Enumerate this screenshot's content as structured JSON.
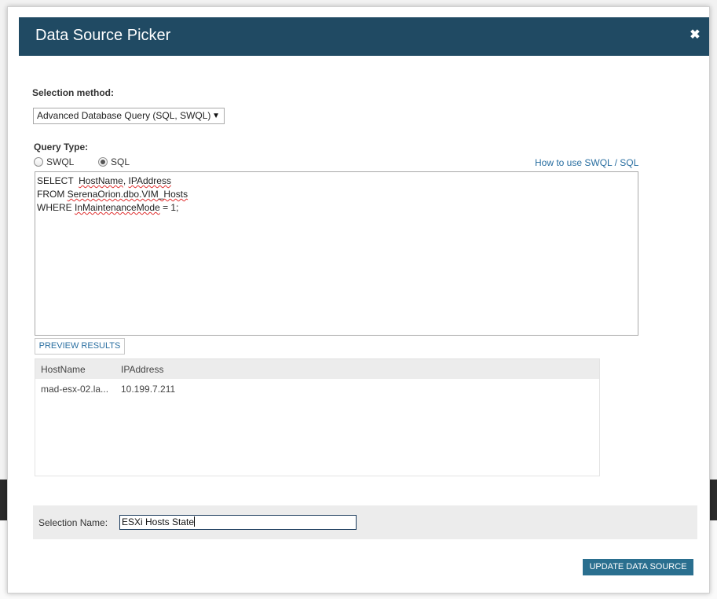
{
  "dialog": {
    "title": "Data Source Picker",
    "close_glyph": "✖"
  },
  "selection_method": {
    "label": "Selection method:",
    "selected": "Advanced Database Query (SQL, SWQL)",
    "arrow": "▼"
  },
  "query_type": {
    "label": "Query Type:",
    "options": [
      {
        "label": "SWQL",
        "checked": false
      },
      {
        "label": "SQL",
        "checked": true
      }
    ],
    "help_link": "How to use SWQL / SQL"
  },
  "query": {
    "line1_prefix": "SELECT  ",
    "line1_word1": "HostName",
    "line1_sep": ", ",
    "line1_word2": "IPAddress",
    "line2_prefix": "FROM ",
    "line2_word": "SerenaOrion.dbo.VIM_Hosts",
    "line3_prefix": "WHERE ",
    "line3_word": "InMaintenanceMode",
    "line3_suffix": " = 1;"
  },
  "preview_button": "PREVIEW RESULTS",
  "results": {
    "columns": [
      "HostName",
      "IPAddress"
    ],
    "rows": [
      [
        "mad-esx-02.la...",
        "10.199.7.211"
      ]
    ]
  },
  "selection_name": {
    "label": "Selection Name:",
    "value": "ESXi Hosts State"
  },
  "update_button": "UPDATE DATA SOURCE",
  "colors": {
    "titlebar": "#204a63",
    "link": "#2a6fa1",
    "primary_button": "#2a6f8f"
  }
}
